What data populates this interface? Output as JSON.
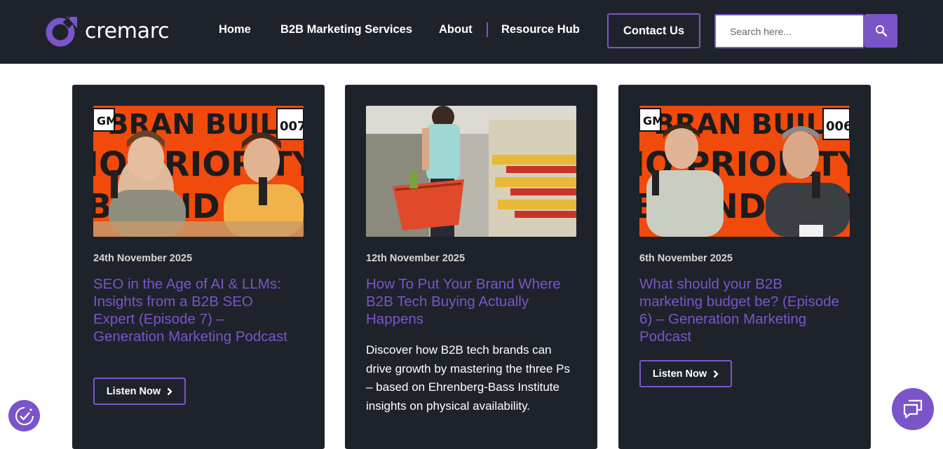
{
  "header": {
    "logo_text": "cremarc",
    "nav": [
      {
        "label": "Home"
      },
      {
        "label": "B2B Marketing Services"
      },
      {
        "label": "About"
      },
      {
        "label": "Resource Hub"
      }
    ],
    "contact_label": "Contact Us",
    "search": {
      "placeholder": "Search here...",
      "value": ""
    }
  },
  "cards": [
    {
      "date": "24th November 2025",
      "title": "SEO in the Age of AI & LLMs: Insights from a B2B SEO Expert (Episode 7) – Generation Marketing Podcast",
      "button": "Listen Now",
      "thumb": {
        "banner": "BRAN BUILDING",
        "episode": "007",
        "badge": "GM"
      }
    },
    {
      "date": "12th November 2025",
      "title": "How To Put Your Brand Where B2B Tech Buying Actually Happens",
      "description": "Discover how B2B tech brands can drive growth by mastering the three Ps – based on Ehrenberg-Bass Institute insights on physical availability."
    },
    {
      "date": "6th November 2025",
      "title": "What should your B2B marketing budget be? (Episode 6) – Generation Marketing Podcast",
      "button": "Listen Now",
      "thumb": {
        "banner": "BRAN BUILDING",
        "episode": "006",
        "badge": "GM"
      }
    }
  ],
  "colors": {
    "accent": "#7a55c9",
    "dark": "#1e232b",
    "podcast_orange": "#f04a0c"
  },
  "icons": {
    "search": "search-icon",
    "chevron": "chevron-right-icon",
    "accessibility": "accessibility-icon",
    "chat": "chat-icon"
  }
}
